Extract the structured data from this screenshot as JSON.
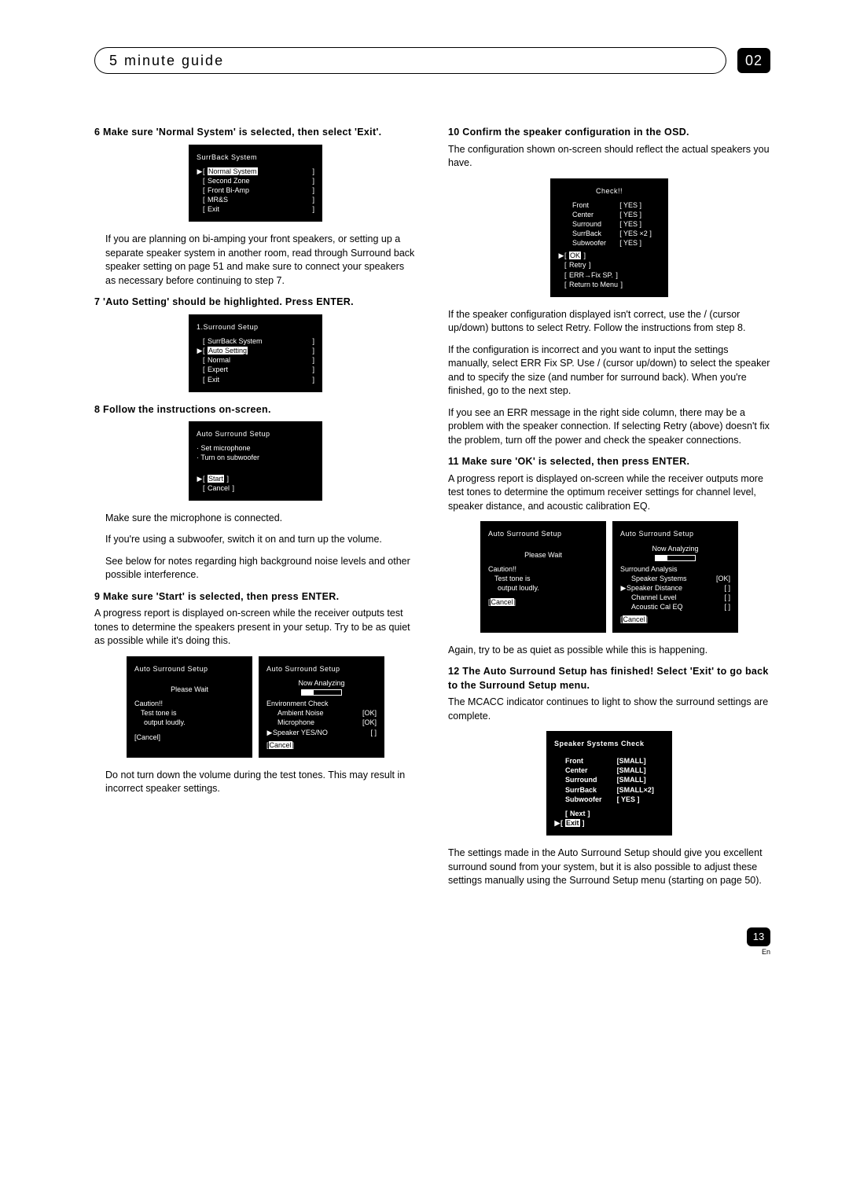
{
  "header": {
    "title": "5 minute guide",
    "chapter": "02"
  },
  "left": {
    "s6_head": "6   Make sure 'Normal System' is selected, then select 'Exit'.",
    "osd1": {
      "title": "SurrBack System",
      "rows": [
        {
          "ptr": "▶",
          "l": "[",
          "label": "Normal System",
          "r": "]",
          "hl": true
        },
        {
          "ptr": "",
          "l": "[",
          "label": "Second Zone",
          "r": "]"
        },
        {
          "ptr": "",
          "l": "[",
          "label": "Front Bi-Amp",
          "r": "]"
        },
        {
          "ptr": "",
          "l": "[",
          "label": "MR&S",
          "r": "]"
        },
        {
          "ptr": "",
          "l": "[",
          "label": "Exit",
          "r": "]"
        }
      ]
    },
    "p6a": "If you are planning on bi-amping your front speakers, or setting up a separate speaker system in another room, read through Surround back speaker setting on page 51 and make sure to connect your speakers as necessary before continuing to step 7.",
    "s7_head": "7   'Auto Setting' should be highlighted. Press ENTER.",
    "osd2": {
      "title": "1.Surround Setup",
      "rows": [
        {
          "ptr": "",
          "l": "[",
          "label": "SurrBack System",
          "r": "]"
        },
        {
          "ptr": "▶",
          "l": "[",
          "label": "Auto Setting",
          "r": "]",
          "hl": true
        },
        {
          "ptr": "",
          "l": "[",
          "label": "Normal",
          "r": "]"
        },
        {
          "ptr": "",
          "l": "[",
          "label": "Expert",
          "r": "]"
        },
        {
          "ptr": "",
          "l": "[",
          "label": "Exit",
          "r": "]"
        }
      ]
    },
    "s8_head": "8   Follow the instructions on-screen.",
    "osd3": {
      "title": "Auto Surround Setup",
      "lines": [
        "· Set microphone",
        "· Turn on subwoofer"
      ],
      "buttons": [
        {
          "ptr": "▶",
          "l": "[",
          "label": "Start",
          "r": "]",
          "hl": true
        },
        {
          "ptr": "",
          "l": "[",
          "label": "Cancel",
          "r": "]"
        }
      ]
    },
    "p8a": "Make sure the microphone is connected.",
    "p8b": "If you're using a subwoofer, switch it on and turn up the volume.",
    "p8c": "See below for notes regarding high background noise levels and other possible interference.",
    "s9_head": "9   Make sure 'Start' is selected, then press ENTER.",
    "p9a": "A progress report is displayed on-screen while the receiver outputs test tones to determine the speakers present in your setup. Try to be as quiet as possible while it's doing this.",
    "osd4a": {
      "title": "Auto Surround Setup",
      "l1": "Please Wait",
      "caution_t": "Caution!!",
      "caution_1": "Test tone is",
      "caution_2": "output loudly.",
      "btn": {
        "l": "[",
        "label": "Cancel",
        "r": "]",
        "hl": false
      }
    },
    "osd4b": {
      "title": "Auto Surround Setup",
      "l1": "Now Analyzing",
      "group": "Environment Check",
      "rows": [
        {
          "label": "Ambient Noise",
          "val": "[OK]"
        },
        {
          "label": "Microphone",
          "val": "[OK]"
        },
        {
          "ptr": "▶",
          "label": "Speaker YES/NO",
          "val": "[    ]"
        }
      ],
      "btn": {
        "l": "[",
        "label": "Cancel",
        "r": "]",
        "hl": true
      }
    },
    "p9b": "Do not turn down the volume during the test tones. This may result in incorrect speaker settings."
  },
  "right": {
    "s10_head": "10  Confirm the speaker configuration in the OSD.",
    "p10a": "The configuration shown on-screen should reflect the actual speakers you have.",
    "osd5": {
      "title": "Check!!",
      "rows": [
        {
          "label": "Front",
          "val": "[ YES   ]"
        },
        {
          "label": "Center",
          "val": "[ YES   ]"
        },
        {
          "label": "Surround",
          "val": "[ YES   ]"
        },
        {
          "label": "SurrBack",
          "val": "[ YES ×2 ]"
        },
        {
          "label": "Subwoofer",
          "val": "[ YES   ]"
        }
      ],
      "buttons": [
        {
          "ptr": "▶",
          "l": "[",
          "label": "OK",
          "r": "]",
          "hl": true
        },
        {
          "ptr": "",
          "l": "[",
          "label": "Retry",
          "r": "]"
        },
        {
          "ptr": "",
          "l": "[",
          "label": "ERR→Fix SP.",
          "r": "]"
        },
        {
          "ptr": "",
          "l": "[",
          "label": "Return to Menu",
          "r": "]"
        }
      ]
    },
    "p10b": "If the speaker configuration displayed isn't correct, use the  /  (cursor up/down) buttons to select Retry. Follow the instructions from step 8.",
    "p10c": "If the configuration is incorrect and you want to input the settings manually, select ERR  Fix SP. Use  /  (cursor up/down) to select the speaker and to specify the size (and number for surround back). When you're finished, go to the next step.",
    "p10d": "If you see an ERR message in the right side column, there may be a problem with the speaker connection. If selecting Retry (above) doesn't fix the problem, turn off the power and check the speaker connections.",
    "s11_head": "11  Make sure 'OK' is selected, then press ENTER.",
    "p11a": "A progress report is displayed on-screen while the receiver outputs more test tones to determine the optimum receiver settings for channel level, speaker distance, and acoustic calibration EQ.",
    "osd6a": {
      "title": "Auto Surround Setup",
      "l1": "Please Wait",
      "caution_t": "Caution!!",
      "caution_1": "Test tone is",
      "caution_2": "output loudly.",
      "btn": {
        "l": "[",
        "label": "Cancel",
        "r": "]",
        "hl": true
      }
    },
    "osd6b": {
      "title": "Auto Surround Setup",
      "l1": "Now Analyzing",
      "group": "Surround Analysis",
      "rows": [
        {
          "label": "Speaker Systems",
          "val": "[OK]"
        },
        {
          "ptr": "▶",
          "label": "Speaker Distance",
          "val": "[    ]"
        },
        {
          "label": "Channel Level",
          "val": "[    ]"
        },
        {
          "label": "Acoustic Cal EQ",
          "val": "[    ]"
        }
      ],
      "btn": {
        "l": "[",
        "label": "Cancel",
        "r": "]",
        "hl": true
      }
    },
    "p11b": "Again, try to be as quiet as possible while this is happening.",
    "s12_head": "12  The Auto Surround Setup has finished! Select 'Exit' to go back to the Surround Setup menu.",
    "p12a": "The MCACC indicator continues to light to show the surround settings are complete.",
    "osd7": {
      "title": "Speaker Systems Check",
      "rows": [
        {
          "label": "Front",
          "val": "[SMALL]"
        },
        {
          "label": "Center",
          "val": "[SMALL]"
        },
        {
          "label": "Surround",
          "val": "[SMALL]"
        },
        {
          "label": "SurrBack",
          "val": "[SMALL×2]"
        },
        {
          "label": "Subwoofer",
          "val": "[  YES  ]"
        }
      ],
      "buttons": [
        {
          "ptr": "",
          "l": "[",
          "label": "Next",
          "r": "]"
        },
        {
          "ptr": "▶",
          "l": "[",
          "label": "Exit",
          "r": "]",
          "hl": true
        }
      ]
    },
    "p12b": "The settings made in the Auto Surround Setup should give you excellent surround sound from your system, but it is also possible to adjust these settings manually using the Surround Setup menu (starting on page 50)."
  },
  "footer": {
    "page": "13",
    "lang": "En"
  }
}
